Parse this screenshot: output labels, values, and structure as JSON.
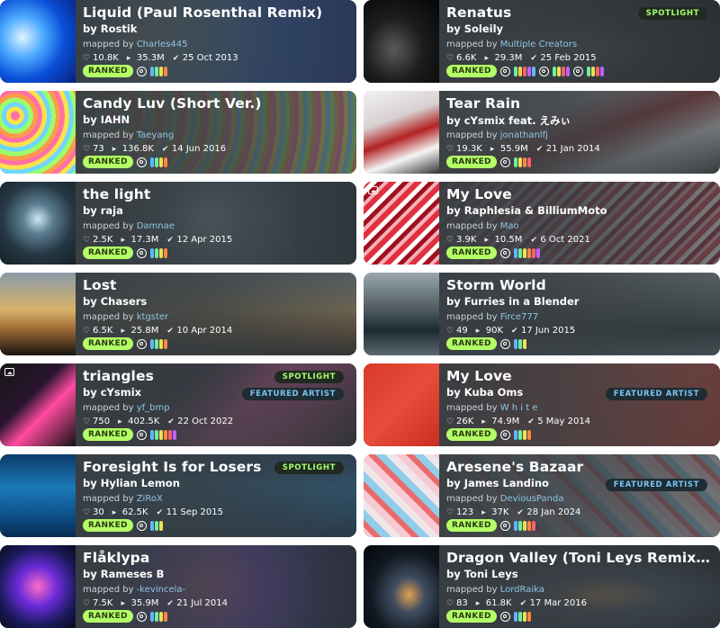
{
  "labels": {
    "mapped_by": "mapped by",
    "ranked": "RANKED",
    "spotlight": "SPOTLIGHT",
    "featured_artist": "FEATURED ARTIST"
  },
  "colors": {
    "ranked_badge": "#b3ff66",
    "mapper_link": "#8fc6e5",
    "card_bg": "#3e4548",
    "spotlight_text": "#a8ff6b",
    "featured_text": "#79c4ef"
  },
  "cards": [
    {
      "title": "Liquid (Paul Rosenthal Remix)",
      "artist": "by Rostik",
      "mapper": "Charles445",
      "favourites": "10.8K",
      "plays": "35.3M",
      "date": "25 Oct 2013",
      "status": "RANKED",
      "spotlight": false,
      "featured": false
    },
    {
      "title": "Renatus",
      "artist": "by Soleily",
      "mapper": "Multiple Creators",
      "favourites": "6.6K",
      "plays": "29.3M",
      "date": "25 Feb 2015",
      "status": "RANKED",
      "spotlight": true,
      "featured": false
    },
    {
      "title": "Candy Luv (Short Ver.)",
      "artist": "by IAHN",
      "mapper": "Taeyang",
      "favourites": "73",
      "plays": "136.8K",
      "date": "14 Jun 2016",
      "status": "RANKED",
      "spotlight": false,
      "featured": false
    },
    {
      "title": "Tear Rain",
      "artist": "by cYsmix feat. えみぃ",
      "mapper": "jonathanlfj",
      "favourites": "19.3K",
      "plays": "55.9M",
      "date": "21 Jan 2014",
      "status": "RANKED",
      "spotlight": false,
      "featured": false
    },
    {
      "title": "the light",
      "artist": "by raja",
      "mapper": "Damnae",
      "favourites": "2.5K",
      "plays": "17.3M",
      "date": "12 Apr 2015",
      "status": "RANKED",
      "spotlight": false,
      "featured": false
    },
    {
      "title": "My Love",
      "artist": "by Raphlesia & BilliumMoto",
      "mapper": "Mao",
      "favourites": "3.9K",
      "plays": "10.5M",
      "date": "6 Oct 2021",
      "status": "RANKED",
      "spotlight": false,
      "featured": false
    },
    {
      "title": "Lost",
      "artist": "by Chasers",
      "mapper": "ktgster",
      "favourites": "6.5K",
      "plays": "25.8M",
      "date": "10 Apr 2014",
      "status": "RANKED",
      "spotlight": false,
      "featured": false
    },
    {
      "title": "Storm World",
      "artist": "by Furries in a Blender",
      "mapper": "Firce777",
      "favourites": "49",
      "plays": "90K",
      "date": "17 Jun 2015",
      "status": "RANKED",
      "spotlight": false,
      "featured": false
    },
    {
      "title": "triangles",
      "artist": "by cYsmix",
      "mapper": "yf_bmp",
      "favourites": "750",
      "plays": "402.5K",
      "date": "22 Oct 2022",
      "status": "RANKED",
      "spotlight": true,
      "featured": true
    },
    {
      "title": "My Love",
      "artist": "by Kuba Oms",
      "mapper": "W h i t e",
      "favourites": "26K",
      "plays": "74.9M",
      "date": "5 May 2014",
      "status": "RANKED",
      "spotlight": false,
      "featured": true
    },
    {
      "title": "Foresight Is for Losers",
      "artist": "by Hylian Lemon",
      "mapper": "ZiRoX",
      "favourites": "30",
      "plays": "62.5K",
      "date": "11 Sep 2015",
      "status": "RANKED",
      "spotlight": true,
      "featured": false
    },
    {
      "title": "Aresene's Bazaar",
      "artist": "by James Landino",
      "mapper": "DeviousPanda",
      "favourites": "123",
      "plays": "37K",
      "date": "28 Jan 2024",
      "status": "RANKED",
      "spotlight": false,
      "featured": true
    },
    {
      "title": "Flåklypa",
      "artist": "by Rameses B",
      "mapper": "-kevincela-",
      "favourites": "7.5K",
      "plays": "35.9M",
      "date": "21 Jul 2014",
      "status": "RANKED",
      "spotlight": false,
      "featured": false
    },
    {
      "title": "Dragon Valley (Toni Leys Remix feat...",
      "artist": "by Toni Leys",
      "mapper": "LordRaika",
      "favourites": "83",
      "plays": "61.8K",
      "date": "17 Mar 2016",
      "status": "RANKED",
      "spotlight": false,
      "featured": false
    }
  ]
}
